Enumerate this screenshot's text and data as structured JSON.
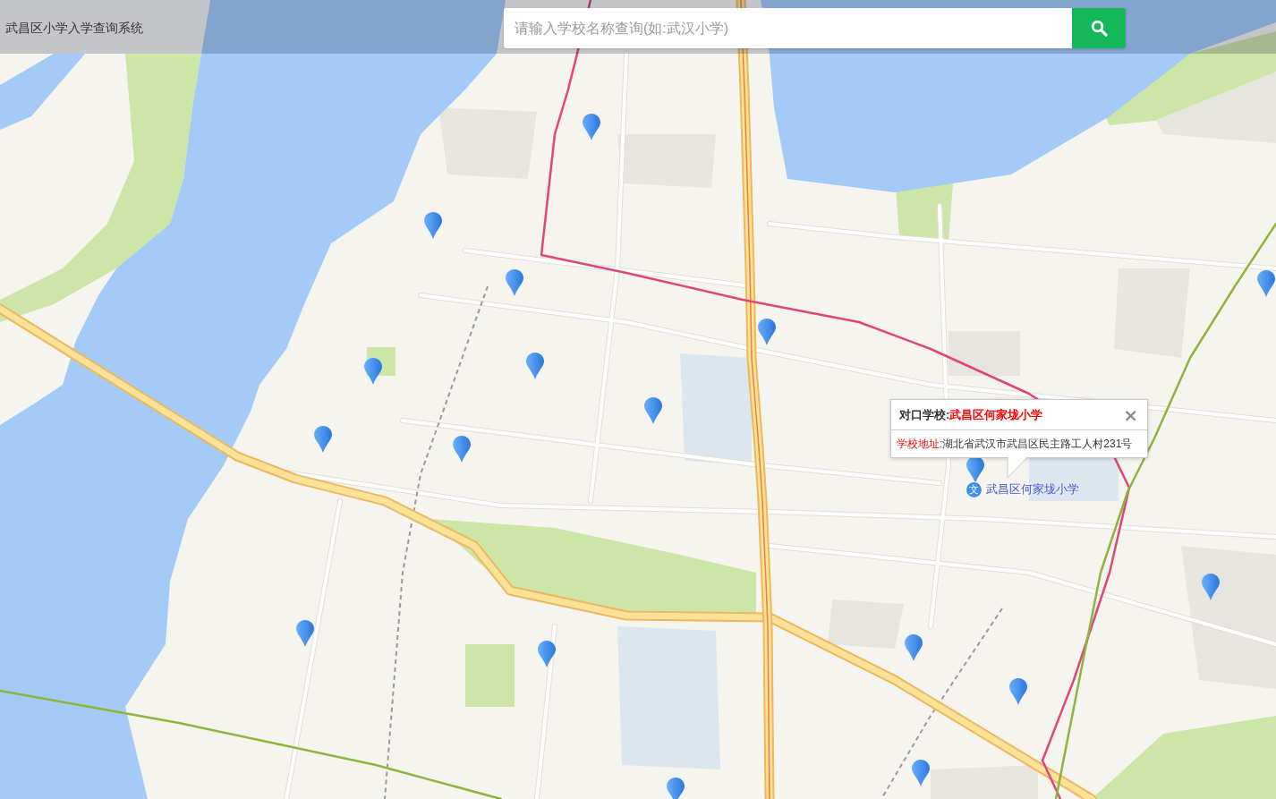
{
  "header": {
    "title": "武昌区小学入学查询系统"
  },
  "search": {
    "placeholder": "请输入学校名称查询(如:武汉小学)"
  },
  "info_window": {
    "title_label": "对口学校:",
    "school": "武昌区何家垅小学",
    "close": "×",
    "address_label": "学校地址:",
    "address": "湖北省武汉市武昌区民主路工人村231号"
  },
  "selected_marker": {
    "icon_text": "文",
    "label": "武昌区何家垅小学"
  }
}
